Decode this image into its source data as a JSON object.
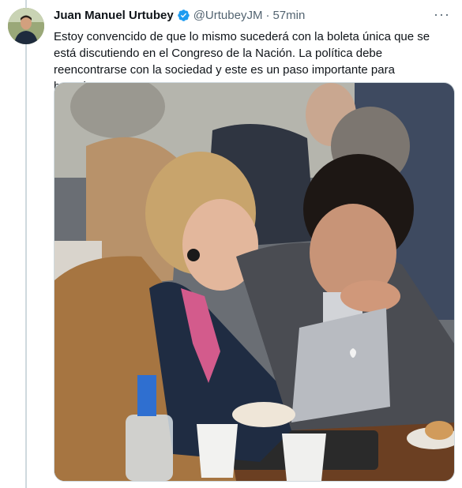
{
  "tweet": {
    "author_name": "Juan Manuel Urtubey",
    "handle": "@UrtubeyJM",
    "separator": "·",
    "time": "57min",
    "more_label": "···",
    "text": "Estoy convencido de que lo mismo sucederá con la boleta única que se está discutiendo en el Congreso de la Nación. La política debe reencontrarse con la sociedad y este es un paso importante para hacerlo.",
    "verified_color": "#1d9bf0",
    "media_icon": "photo"
  }
}
